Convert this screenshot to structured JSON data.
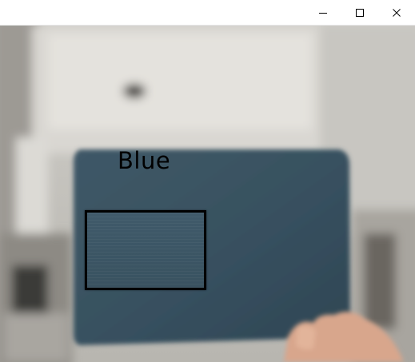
{
  "window": {
    "title": "",
    "controls": {
      "minimize_icon": "minimize-icon",
      "maximize_icon": "maximize-icon",
      "close_icon": "close-icon"
    }
  },
  "detection": {
    "label": "Blue",
    "label_color": "#000000",
    "box_color": "#000000"
  },
  "colors": {
    "object": "#3a5262",
    "background": "#bfbcb6"
  }
}
